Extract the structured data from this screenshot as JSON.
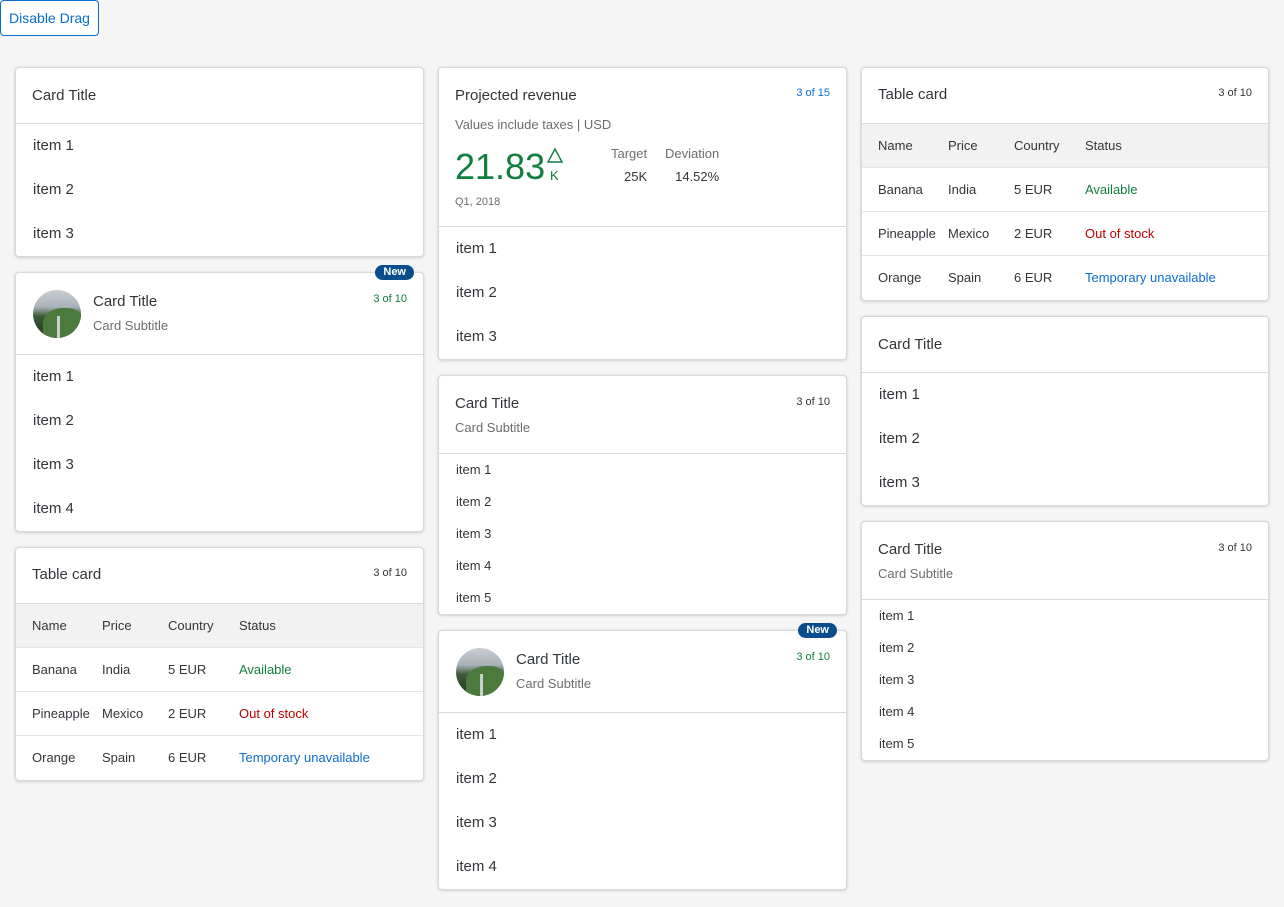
{
  "toolbar": {
    "disable_drag_label": "Disable Drag"
  },
  "col1": {
    "card1": {
      "title": "Card Title",
      "items": [
        "item 1",
        "item 2",
        "item 3"
      ]
    },
    "card2": {
      "badge": "New",
      "title": "Card Title",
      "subtitle": "Card Subtitle",
      "status": "3 of 10",
      "items": [
        "item 1",
        "item 2",
        "item 3",
        "item 4"
      ]
    },
    "card3": {
      "title": "Table card",
      "status": "3 of 10",
      "columns": [
        "Name",
        "Price",
        "Country",
        "Status"
      ],
      "rows": [
        [
          "Banana",
          "India",
          "5 EUR",
          "Available"
        ],
        [
          "Pineapple",
          "Mexico",
          "2 EUR",
          "Out of stock"
        ],
        [
          "Orange",
          "Spain",
          "6 EUR",
          "Temporary unavailable"
        ]
      ]
    }
  },
  "col2": {
    "card1": {
      "title": "Projected revenue",
      "subtitle": "Values include taxes | USD",
      "status": "3 of 15",
      "kpi": {
        "value": "21.83",
        "scale": "K",
        "trend": "up",
        "details": "Q1, 2018"
      },
      "side": [
        {
          "label": "Target",
          "value": "25K"
        },
        {
          "label": "Deviation",
          "value": "14.52%"
        }
      ],
      "items": [
        "item 1",
        "item 2",
        "item 3"
      ]
    },
    "card2": {
      "title": "Card Title",
      "subtitle": "Card Subtitle",
      "status": "3 of 10",
      "items": [
        "item 1",
        "item 2",
        "item 3",
        "item 4",
        "item 5"
      ]
    },
    "card3": {
      "badge": "New",
      "title": "Card Title",
      "subtitle": "Card Subtitle",
      "status": "3 of 10",
      "items": [
        "item 1",
        "item 2",
        "item 3",
        "item 4"
      ]
    }
  },
  "col3": {
    "card1": {
      "title": "Table card",
      "status": "3 of 10",
      "columns": [
        "Name",
        "Price",
        "Country",
        "Status"
      ],
      "rows": [
        [
          "Banana",
          "India",
          "5 EUR",
          "Available"
        ],
        [
          "Pineapple",
          "Mexico",
          "2 EUR",
          "Out of stock"
        ],
        [
          "Orange",
          "Spain",
          "6 EUR",
          "Temporary unavailable"
        ]
      ]
    },
    "card2": {
      "title": "Card Title",
      "items": [
        "item 1",
        "item 2",
        "item 3"
      ]
    },
    "card3": {
      "title": "Card Title",
      "subtitle": "Card Subtitle",
      "status": "3 of 10",
      "items": [
        "item 1",
        "item 2",
        "item 3",
        "item 4",
        "item 5"
      ]
    }
  },
  "colors": {
    "accent": "#0a6ed1",
    "positive": "#107e3e",
    "negative": "#bb0000",
    "badge": "#0a4d8c"
  }
}
